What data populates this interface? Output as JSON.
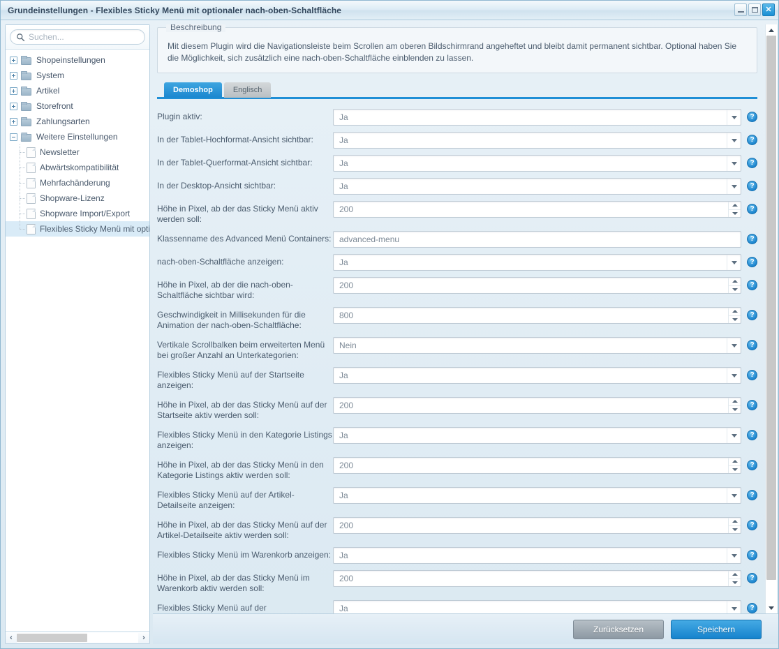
{
  "window": {
    "title": "Grundeinstellungen - Flexibles Sticky Menü mit optionaler nach-oben-Schaltfläche",
    "minimize_label": "",
    "maximize_label": "",
    "close_label": "✕"
  },
  "sidebar": {
    "search": {
      "placeholder": "Suchen...",
      "value": ""
    },
    "tree": [
      {
        "label": "Shopeinstellungen",
        "type": "folder",
        "state": "collapsed",
        "level": 0
      },
      {
        "label": "System",
        "type": "folder",
        "state": "collapsed",
        "level": 0
      },
      {
        "label": "Artikel",
        "type": "folder",
        "state": "collapsed",
        "level": 0
      },
      {
        "label": "Storefront",
        "type": "folder",
        "state": "collapsed",
        "level": 0
      },
      {
        "label": "Zahlungsarten",
        "type": "folder",
        "state": "collapsed",
        "level": 0
      },
      {
        "label": "Weitere Einstellungen",
        "type": "folder",
        "state": "expanded",
        "level": 0
      },
      {
        "label": "Newsletter",
        "type": "doc",
        "level": 1
      },
      {
        "label": "Abwärtskompatibilität",
        "type": "doc",
        "level": 1
      },
      {
        "label": "Mehrfachänderung",
        "type": "doc",
        "level": 1
      },
      {
        "label": "Shopware-Lizenz",
        "type": "doc",
        "level": 1
      },
      {
        "label": "Shopware Import/Export",
        "type": "doc",
        "level": 1
      },
      {
        "label": "Flexibles Sticky Menü mit optio",
        "type": "doc",
        "level": 1,
        "selected": true
      }
    ],
    "hscroll": {
      "left_arrow": "‹",
      "right_arrow": "›"
    }
  },
  "description": {
    "legend": "Beschreibung",
    "text": "Mit diesem Plugin wird die Navigationsleiste beim Scrollen am oberen Bildschirmrand angeheftet und bleibt damit permanent sichtbar. Optional haben Sie die Möglichkeit, sich zusätzlich eine nach-oben-Schaltfläche einblenden zu lassen."
  },
  "tabs": [
    {
      "label": "Demoshop",
      "active": true
    },
    {
      "label": "Englisch",
      "active": false
    }
  ],
  "form": {
    "help_glyph": "?",
    "rows": [
      {
        "label": "Plugin aktiv:",
        "value": "Ja",
        "type": "select"
      },
      {
        "label": "In der Tablet-Hochformat-Ansicht sichtbar:",
        "value": "Ja",
        "type": "select"
      },
      {
        "label": "In der Tablet-Querformat-Ansicht sichtbar:",
        "value": "Ja",
        "type": "select"
      },
      {
        "label": "In der Desktop-Ansicht sichtbar:",
        "value": "Ja",
        "type": "select"
      },
      {
        "label": "Höhe in Pixel, ab der das Sticky Menü aktiv werden soll:",
        "value": "200",
        "type": "spinner"
      },
      {
        "label": "Klassenname des Advanced Menü Containers:",
        "value": "advanced-menu",
        "type": "text"
      },
      {
        "label": "nach-oben-Schaltfläche anzeigen:",
        "value": "Ja",
        "type": "select"
      },
      {
        "label": "Höhe in Pixel, ab der die nach-oben-Schaltfläche sichtbar wird:",
        "value": "200",
        "type": "spinner"
      },
      {
        "label": "Geschwindigkeit in Millisekunden für die Animation der nach-oben-Schaltfläche:",
        "value": "800",
        "type": "spinner"
      },
      {
        "label": "Vertikale Scrollbalken beim erweiterten Menü bei großer Anzahl an Unterkategorien:",
        "value": "Nein",
        "type": "select"
      },
      {
        "label": "Flexibles Sticky Menü auf der Startseite anzeigen:",
        "value": "Ja",
        "type": "select"
      },
      {
        "label": "Höhe in Pixel, ab der das Sticky Menü auf der Startseite aktiv werden soll:",
        "value": "200",
        "type": "spinner"
      },
      {
        "label": "Flexibles Sticky Menü in den Kategorie Listings anzeigen:",
        "value": "Ja",
        "type": "select"
      },
      {
        "label": "Höhe in Pixel, ab der das Sticky Menü in den Kategorie Listings aktiv werden soll:",
        "value": "200",
        "type": "spinner"
      },
      {
        "label": "Flexibles Sticky Menü auf der Artikel-Detailseite anzeigen:",
        "value": "Ja",
        "type": "select"
      },
      {
        "label": "Höhe in Pixel, ab der das Sticky Menü auf der Artikel-Detailseite aktiv werden soll:",
        "value": "200",
        "type": "spinner"
      },
      {
        "label": "Flexibles Sticky Menü im Warenkorb anzeigen:",
        "value": "Ja",
        "type": "select"
      },
      {
        "label": "Höhe in Pixel, ab der das Sticky Menü im Warenkorb aktiv werden soll:",
        "value": "200",
        "type": "spinner"
      },
      {
        "label": "Flexibles Sticky Menü auf der Registrierungsseite anzeigen:",
        "value": "Ja",
        "type": "select"
      }
    ]
  },
  "footer": {
    "reset_label": "Zurücksetzen",
    "save_label": "Speichern"
  }
}
